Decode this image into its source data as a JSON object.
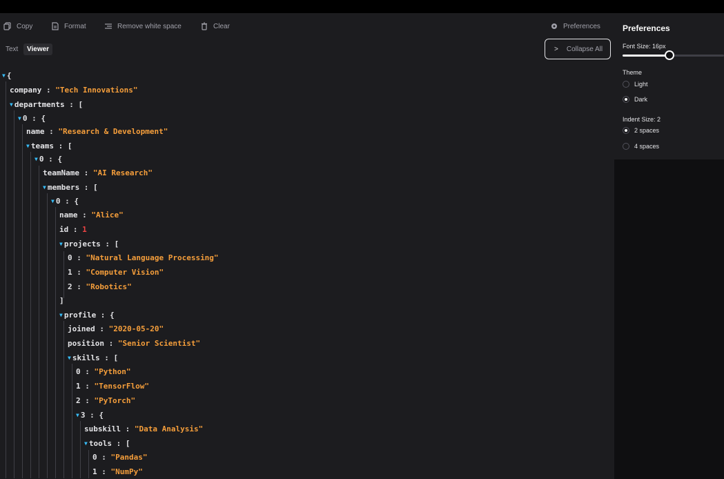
{
  "toolbar": {
    "copy": "Copy",
    "format": "Format",
    "remove_whitespace": "Remove white space",
    "clear": "Clear",
    "preferences": "Preferences"
  },
  "tabs": {
    "text": "Text",
    "viewer": "Viewer"
  },
  "collapse_all": "Collapse All",
  "preferences": {
    "title": "Preferences",
    "font_size_label": "Font Size: 16px",
    "font_size_level": 0.47,
    "theme_label": "Theme",
    "theme_options": [
      "Light",
      "Dark"
    ],
    "theme_selected": "Dark",
    "indent_label": "Indent Size: 2",
    "indent_options": [
      "2 spaces",
      "4 spaces"
    ],
    "indent_selected": "2 spaces"
  },
  "tree": {
    "root_open": "{",
    "company_key": "company",
    "company_val": "\"Tech Innovations\"",
    "departments_key": "departments",
    "d0_key": "0",
    "name_key": "name",
    "d0_name": "\"Research & Development\"",
    "teams_key": "teams",
    "t0_key": "0",
    "teamName_key": "teamName",
    "teamName_val": "\"AI Research\"",
    "members_key": "members",
    "m0_key": "0",
    "m0_name": "\"Alice\"",
    "id_key": "id",
    "id_val": "1",
    "projects_key": "projects",
    "projects": [
      "\"Natural Language Processing\"",
      "\"Computer Vision\"",
      "\"Robotics\""
    ],
    "profile_key": "profile",
    "joined_key": "joined",
    "joined_val": "\"2020-05-20\"",
    "position_key": "position",
    "position_val": "\"Senior Scientist\"",
    "skills_key": "skills",
    "skills": [
      "\"Python\"",
      "\"TensorFlow\"",
      "\"PyTorch\""
    ],
    "s3_key": "3",
    "subskill_key": "subskill",
    "subskill_val": "\"Data Analysis\"",
    "tools_key": "tools",
    "tools": [
      "\"Pandas\"",
      "\"NumPy\""
    ]
  },
  "colors": {
    "key": "#e4e4e7",
    "string": "#f59e3b",
    "number": "#ef4444",
    "toggle": "#38bdf8",
    "background": "#1c1c1f"
  },
  "icons": [
    "copy-icon",
    "format-icon",
    "remove-whitespace-icon",
    "trash-icon",
    "gear-icon",
    "chevron-right-icon",
    "triangle-down-icon"
  ]
}
